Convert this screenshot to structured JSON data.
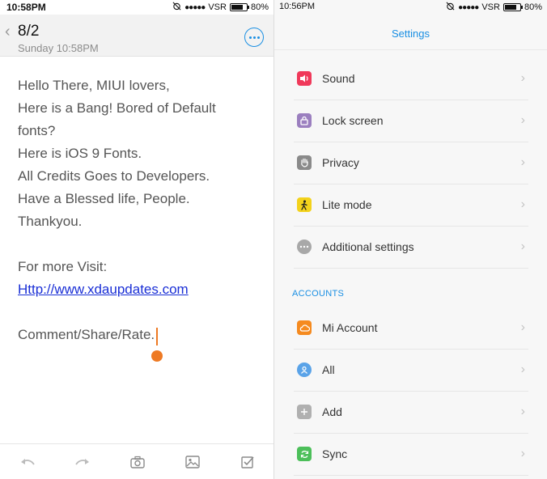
{
  "left": {
    "status": {
      "time": "10:58PM",
      "carrier": "VSR",
      "battery": "80%",
      "battery_level": 0.8,
      "signal_dots": "●●●●●"
    },
    "header": {
      "title": "8/2",
      "date": "Sunday 10:58PM"
    },
    "body_lines": [
      "Hello There, MIUI lovers,",
      "Here is a Bang! Bored of Default",
      "fonts?",
      "Here is iOS 9 Fonts.",
      "All Credits Goes to Developers.",
      "Have a Blessed life, People.",
      "Thankyou.",
      "",
      "For more Visit:",
      "Http://www.xdaupdates.com",
      "",
      "Comment/Share/Rate."
    ],
    "toolbar_icons": [
      "undo-icon",
      "redo-icon",
      "camera-icon",
      "image-icon",
      "checklist-icon"
    ]
  },
  "right": {
    "status": {
      "time": "10:56PM",
      "carrier": "VSR",
      "battery": "80%",
      "battery_level": 0.8,
      "signal_dots": "●●●●●"
    },
    "title": "Settings",
    "items": [
      {
        "label": "Sound",
        "icon": "sound-icon",
        "color": "#f0395a"
      },
      {
        "label": "Lock screen",
        "icon": "lock-icon",
        "color": "#9b7fbf"
      },
      {
        "label": "Privacy",
        "icon": "hand-icon",
        "color": "#8a8a8a"
      },
      {
        "label": "Lite mode",
        "icon": "walk-icon",
        "color": "#f3d21c"
      },
      {
        "label": "Additional settings",
        "icon": "more-icon",
        "color": "#a8a8a8"
      }
    ],
    "accounts_label": "ACCOUNTS",
    "account_items": [
      {
        "label": "Mi Account",
        "icon": "cloud-icon",
        "color": "#f58a1f"
      },
      {
        "label": "All",
        "icon": "person-icon",
        "color": "#5aa3e8"
      },
      {
        "label": "Add",
        "icon": "plus-icon",
        "color": "#b0b0b0"
      },
      {
        "label": "Sync",
        "icon": "sync-icon",
        "color": "#4cbf5a"
      }
    ]
  },
  "colors": {
    "accent": "#1a8fe3",
    "cursor": "#ee7a24",
    "link": "#1a2fd6"
  }
}
